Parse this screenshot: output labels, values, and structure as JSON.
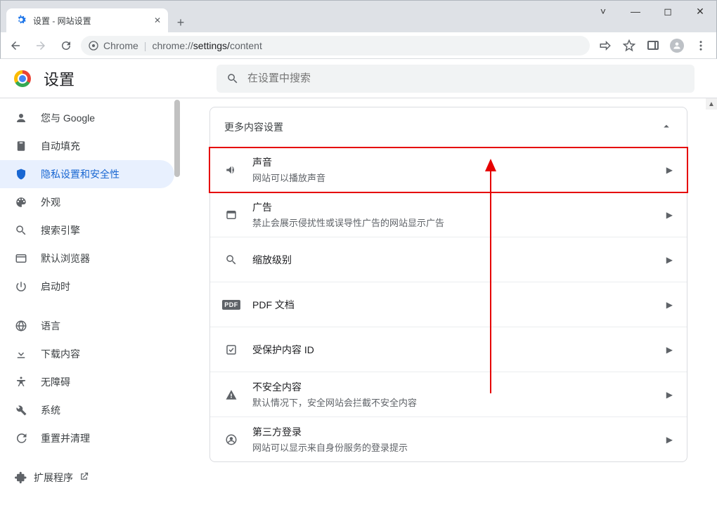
{
  "window": {
    "tab_title": "设置 - 网站设置"
  },
  "omnibox": {
    "badge": "Chrome",
    "host": "chrome://",
    "path_seg1": "settings/",
    "path_seg2": "content"
  },
  "header": {
    "title": "设置",
    "search_placeholder": "在设置中搜索"
  },
  "sidebar": {
    "items": [
      {
        "label": "您与 Google"
      },
      {
        "label": "自动填充"
      },
      {
        "label": "隐私设置和安全性"
      },
      {
        "label": "外观"
      },
      {
        "label": "搜索引擎"
      },
      {
        "label": "默认浏览器"
      },
      {
        "label": "启动时"
      }
    ],
    "items2": [
      {
        "label": "语言"
      },
      {
        "label": "下载内容"
      },
      {
        "label": "无障碍"
      },
      {
        "label": "系统"
      },
      {
        "label": "重置并清理"
      }
    ],
    "extensions_label": "扩展程序"
  },
  "content": {
    "section_title": "更多内容设置",
    "rows": [
      {
        "title": "声音",
        "subtitle": "网站可以播放声音"
      },
      {
        "title": "广告",
        "subtitle": "禁止会展示侵扰性或误导性广告的网站显示广告"
      },
      {
        "title": "缩放级别",
        "subtitle": ""
      },
      {
        "title": "PDF 文档",
        "subtitle": ""
      },
      {
        "title": "受保护内容 ID",
        "subtitle": ""
      },
      {
        "title": "不安全内容",
        "subtitle": "默认情况下，安全网站会拦截不安全内容"
      },
      {
        "title": "第三方登录",
        "subtitle": "网站可以显示来自身份服务的登录提示"
      }
    ]
  }
}
